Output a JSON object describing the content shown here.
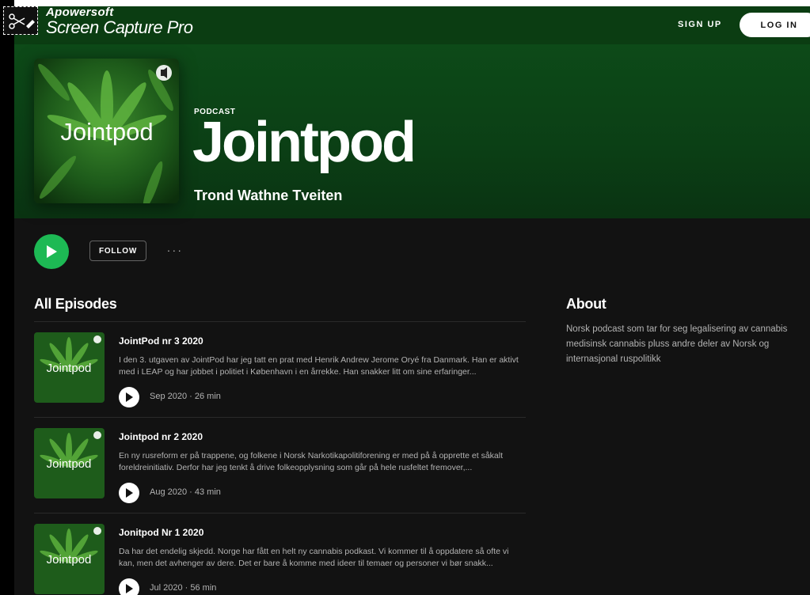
{
  "watermark": {
    "line1": "Apowersoft",
    "line2": "Screen Capture Pro",
    "icon": "scissors-icon"
  },
  "header": {
    "signup_label": "SIGN UP",
    "login_label": "LOG IN"
  },
  "podcast": {
    "kicker": "PODCAST",
    "title": "Jointpod",
    "author": "Trond Wathne Tveiten",
    "cover_text": "Jointpod",
    "accent_color": "#1db954"
  },
  "controls": {
    "follow_label": "FOLLOW",
    "more_label": "..."
  },
  "episodes_section": {
    "heading": "All Episodes",
    "items": [
      {
        "title": "JointPod nr 3 2020",
        "description": "I den 3. utgaven av JointPod har jeg tatt en prat med Henrik Andrew Jerome Oryé fra Danmark. Han er aktivt med i LEAP og har jobbet i politiet i København i en årrekke. Han snakker litt om sine erfaringer...",
        "meta": "Sep 2020 · 26 min",
        "thumb_text": "Jointpod"
      },
      {
        "title": "Jointpod nr 2 2020",
        "description": "En ny rusreform er på trappene, og folkene i Norsk Narkotikapolitiforening er med på å opprette et såkalt foreldreinitiativ. Derfor har jeg tenkt å drive folkeopplysning som går på hele rusfeltet fremover,...",
        "meta": "Aug 2020 · 43 min",
        "thumb_text": "Jointpod"
      },
      {
        "title": "Jonitpod Nr 1 2020",
        "description": "Da har det endelig skjedd. Norge har fått en helt ny cannabis podkast. Vi kommer til å oppdatere så ofte vi kan, men det avhenger av dere. Det er bare å komme med ideer til temaer og personer vi bør snakk...",
        "meta": "Jul 2020 · 56 min",
        "thumb_text": "Jointpod"
      }
    ]
  },
  "about": {
    "heading": "About",
    "text": "Norsk podcast som tar for seg legalisering av cannabis medisinsk cannabis pluss andre deler av Norsk og internasjonal ruspolitikk"
  }
}
